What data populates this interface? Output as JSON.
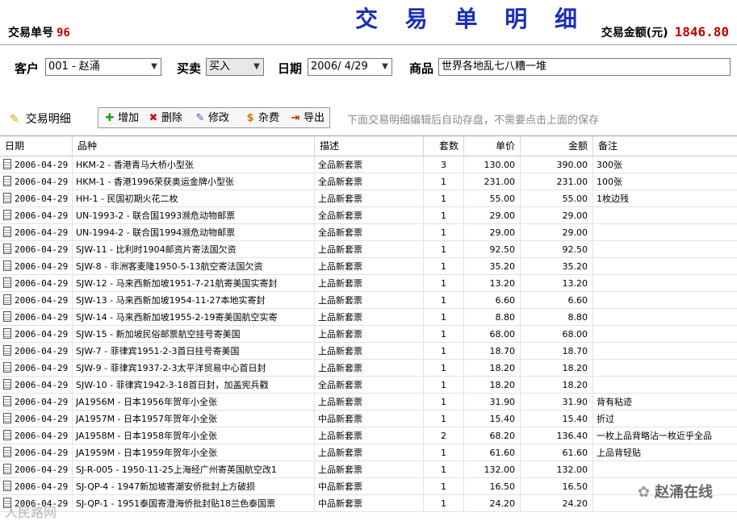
{
  "header": {
    "order_label": "交易单号",
    "order_no": "96",
    "title": "交 易 单 明 细",
    "amount_label": "交易金额(元)",
    "amount": "1846.80"
  },
  "form": {
    "customer_label": "客户",
    "customer_value": "001 - 赵涌",
    "trade_label": "买卖",
    "trade_value": "买入",
    "date_label": "日期",
    "date_value": "2006/ 4/29",
    "goods_label": "商品",
    "goods_value": "世界各地乱七八糟一堆"
  },
  "toolbar": {
    "title": "交易明细",
    "add": "增加",
    "delete": "删除",
    "edit": "修改",
    "fees": "杂费",
    "export": "导出",
    "hint": "下面交易明细编辑后自动存盘，不需要点击上面的保存"
  },
  "grid": {
    "columns": [
      "日期",
      "品种",
      "描述",
      "套数",
      "单价",
      "金额",
      "备注"
    ],
    "rows": [
      [
        "2006-04-29",
        "HKM-2 - 香港青马大桥小型张",
        "全品新套票",
        "3",
        "130.00",
        "390.00",
        "300张"
      ],
      [
        "2006-04-29",
        "HKM-1 - 香港1996荣获奥运金牌小型张",
        "全品新套票",
        "1",
        "231.00",
        "231.00",
        "100张"
      ],
      [
        "2006-04-29",
        "HH-1 - 民国初期火花二枚",
        "上品新套票",
        "1",
        "55.00",
        "55.00",
        "1枚边残"
      ],
      [
        "2006-04-29",
        "UN-1993-2 - 联合国1993濒危动物邮票",
        "全品新套票",
        "1",
        "29.00",
        "29.00",
        ""
      ],
      [
        "2006-04-29",
        "UN-1994-2 - 联合国1994濒危动物邮票",
        "全品新套票",
        "1",
        "29.00",
        "29.00",
        ""
      ],
      [
        "2006-04-29",
        "SJW-11 - 比利时1904邮资片寄法国欠资",
        "上品新套票",
        "1",
        "92.50",
        "92.50",
        ""
      ],
      [
        "2006-04-29",
        "SJW-8 - 非洲客麦隆1950-5-13航空寄法国欠资",
        "上品新套票",
        "1",
        "35.20",
        "35.20",
        ""
      ],
      [
        "2006-04-29",
        "SJW-12 - 马来西新加坡1951-7-21航寄美国实寄封",
        "上品新套票",
        "1",
        "13.20",
        "13.20",
        ""
      ],
      [
        "2006-04-29",
        "SJW-13 - 马来西新加坡1954-11-27本地实寄封",
        "上品新套票",
        "1",
        "6.60",
        "6.60",
        ""
      ],
      [
        "2006-04-29",
        "SJW-14 - 马来西新加坡1955-2-19寄美国航空实寄",
        "上品新套票",
        "1",
        "8.80",
        "8.80",
        ""
      ],
      [
        "2006-04-29",
        "SJW-15 - 新加坡民俗邮票航空挂号寄美国",
        "上品新套票",
        "1",
        "68.00",
        "68.00",
        ""
      ],
      [
        "2006-04-29",
        "SJW-7 - 菲律宾1951-2-3首日挂号寄美国",
        "上品新套票",
        "1",
        "18.70",
        "18.70",
        ""
      ],
      [
        "2006-04-29",
        "SJW-9 - 菲律宾1937-2-3太平洋贸易中心首日封",
        "上品新套票",
        "1",
        "18.20",
        "18.20",
        ""
      ],
      [
        "2006-04-29",
        "SJW-10 - 菲律宾1942-3-18首日封，加盖宪兵戳",
        "全品新套票",
        "1",
        "18.20",
        "18.20",
        ""
      ],
      [
        "2006-04-29",
        "JA1956M - 日本1956年贺年小全张",
        "上品新套票",
        "1",
        "31.90",
        "31.90",
        "背有粘迹"
      ],
      [
        "2006-04-29",
        "JA1957M - 日本1957年贺年小全张",
        "中品新套票",
        "1",
        "15.40",
        "15.40",
        "折过"
      ],
      [
        "2006-04-29",
        "JA1958M - 日本1958年贺年小全张",
        "上品新套票",
        "2",
        "68.20",
        "136.40",
        "一枚上品背略沾一枚近乎全品"
      ],
      [
        "2006-04-29",
        "JA1959M - 日本1959年贺年小全张",
        "上品新套票",
        "1",
        "61.60",
        "61.60",
        "上品背轻贴"
      ],
      [
        "2006-04-29",
        "SJ-R-005 - 1950-11-25上海经广州寄英国航空改1",
        "上品新套票",
        "1",
        "132.00",
        "132.00",
        ""
      ],
      [
        "2006-04-29",
        "SJ-QP-4 - 1947新加坡寄潮安侨批封上方破损",
        "中品新套票",
        "1",
        "16.50",
        "16.50",
        ""
      ],
      [
        "2006-04-29",
        "SJ-QP-1 - 1951泰国寄澄海侨批封贴18兰色泰国票",
        "中品新套票",
        "1",
        "24.20",
        "24.20",
        ""
      ]
    ]
  },
  "watermark": {
    "brand": "赵涌在线",
    "left": "人民路网"
  }
}
